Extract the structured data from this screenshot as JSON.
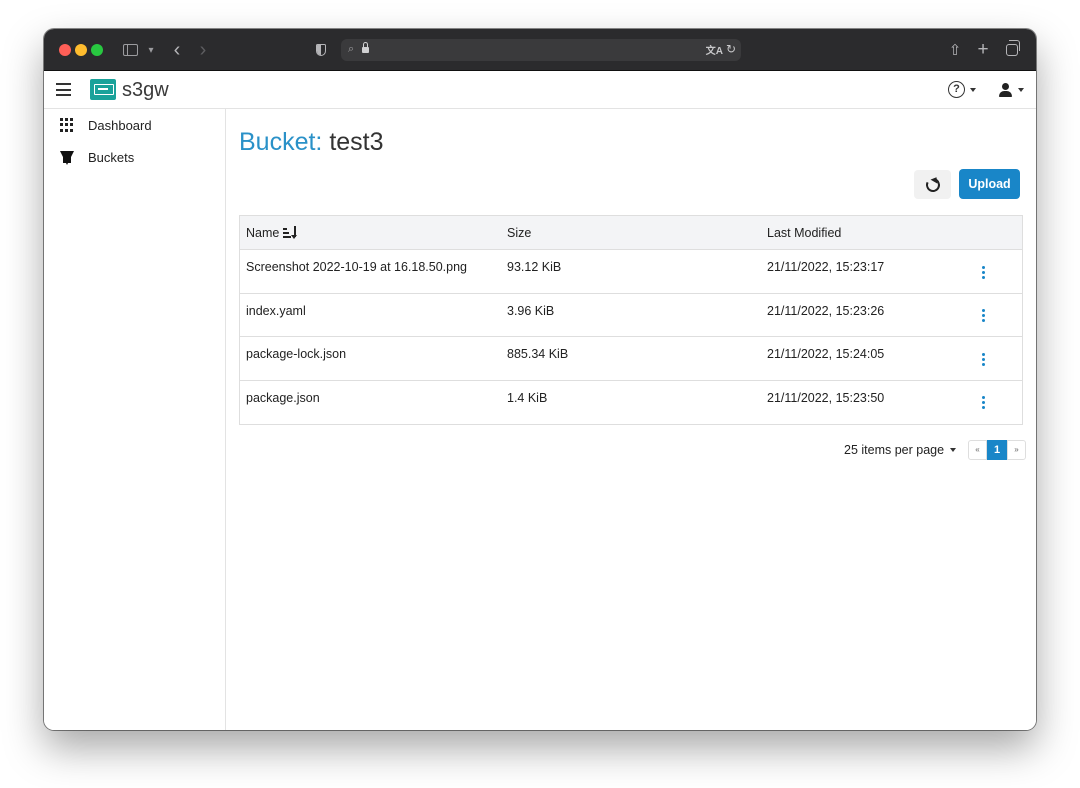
{
  "browser": {
    "icons": {
      "back": "chevron-left-icon",
      "forward": "chevron-right-icon",
      "share": "share-icon",
      "new_tab": "plus-icon",
      "tabs": "tab-overview-icon"
    }
  },
  "header": {
    "brand": "s3gw",
    "brand_color": "#1aa29a"
  },
  "sidebar": {
    "items": [
      {
        "label": "Dashboard",
        "icon": "grid-icon"
      },
      {
        "label": "Buckets",
        "icon": "bucket-icon"
      }
    ]
  },
  "main": {
    "title_prefix": "Bucket:",
    "title_name": "test3",
    "accent_color": "#2a91c8",
    "upload_label": "Upload",
    "table": {
      "columns": [
        "Name",
        "Size",
        "Last Modified"
      ],
      "rows": [
        {
          "name": "Screenshot 2022-10-19 at 16.18.50.png",
          "size": "93.12 KiB",
          "modified": "21/11/2022, 15:23:17"
        },
        {
          "name": "index.yaml",
          "size": "3.96 KiB",
          "modified": "21/11/2022, 15:23:26"
        },
        {
          "name": "package-lock.json",
          "size": "885.34 KiB",
          "modified": "21/11/2022, 15:24:05"
        },
        {
          "name": "package.json",
          "size": "1.4 KiB",
          "modified": "21/11/2022, 15:23:50"
        }
      ]
    },
    "pagination": {
      "per_page_label": "25 items per page",
      "prev": "«",
      "current": "1",
      "next": "»"
    }
  }
}
